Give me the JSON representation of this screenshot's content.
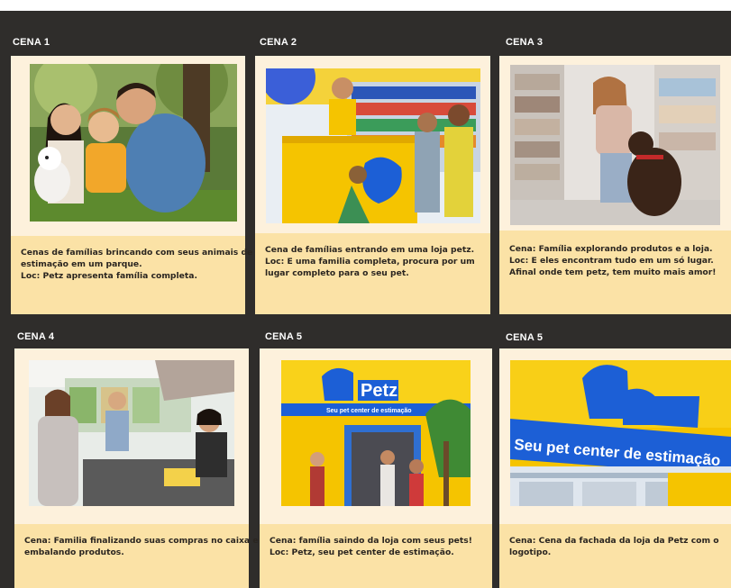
{
  "scenes": [
    {
      "label": "CENA 1",
      "lines": [
        "Cenas de famílias brincando com seus animais de",
        "estimação em um parque.",
        "Loc: Petz apresenta família completa."
      ]
    },
    {
      "label": "CENA 2",
      "lines": [
        "Cena de famílias entrando em uma loja petz.",
        "Loc:  E uma familia completa, procura por um",
        "lugar completo para o seu pet."
      ]
    },
    {
      "label": "CENA 3",
      "lines": [
        "Cena: Família explorando produtos e a loja.",
        "Loc:  E eles encontram tudo em um só lugar.",
        "Afinal onde tem petz, tem muito mais amor!"
      ]
    },
    {
      "label": "CENA 4",
      "lines": [
        "Cena: Familia finalizando suas compras no caixa e",
        "embalando produtos."
      ]
    },
    {
      "label": "CENA 5",
      "lines": [
        "Cena:  família saindo da loja com seus pets!",
        "Loc: Petz, seu pet center de estimação."
      ]
    },
    {
      "label": "CENA 5",
      "lines": [
        "Cena: Cena da fachada da loja da Petz com o",
        "logotipo."
      ]
    }
  ],
  "photos": {
    "store_subtitle": "Seu pet center de estimação",
    "facade_subtitle": "Seu pet center de estimação",
    "brand": "Petz"
  },
  "colors": {
    "board": "#2f2d2b",
    "card": "#fdf1dc",
    "caption": "#fbe2a6",
    "petz_blue": "#1c5fd6",
    "petz_yellow": "#f5c400"
  }
}
